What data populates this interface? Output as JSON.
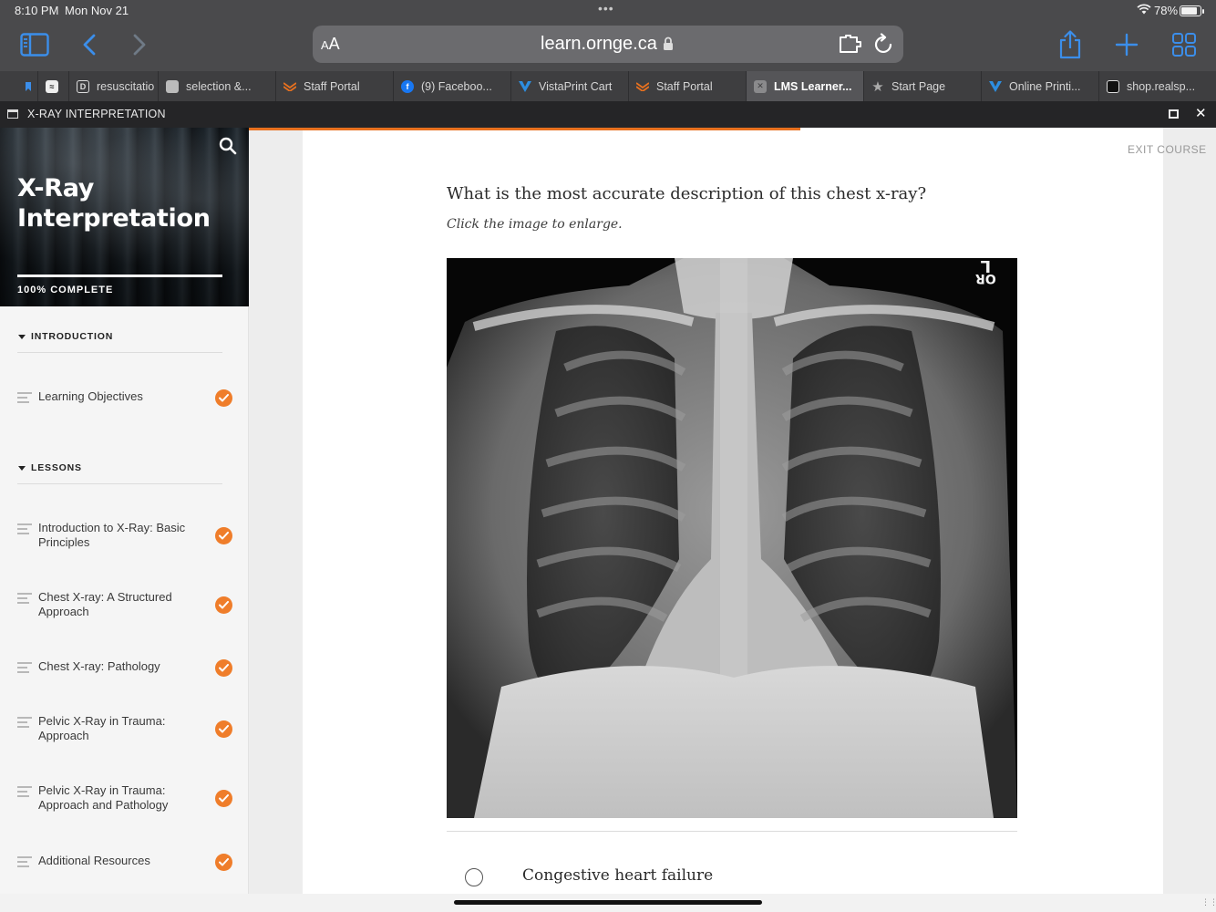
{
  "status_bar": {
    "time": "8:10 PM",
    "date": "Mon Nov 21",
    "battery": "78%"
  },
  "browser": {
    "text_size_label": "AA",
    "url": "learn.ornge.ca",
    "tabs": [
      {
        "label": "",
        "icon": "bookmark-icon"
      },
      {
        "label": "",
        "icon": "app-icon"
      },
      {
        "label": "resuscitatio",
        "icon": "d-square-icon"
      },
      {
        "label": "selection &...",
        "icon": "thumbnail-icon"
      },
      {
        "label": "Staff Portal",
        "icon": "ornge-logo-icon"
      },
      {
        "label": "(9) Faceboo...",
        "icon": "facebook-icon"
      },
      {
        "label": "VistaPrint Cart",
        "icon": "vistaprint-icon"
      },
      {
        "label": "Staff Portal",
        "icon": "ornge-logo-icon"
      },
      {
        "label": "LMS Learner...",
        "icon": "close-icon",
        "active": true
      },
      {
        "label": "Start Page",
        "icon": "star-icon"
      },
      {
        "label": "Online Printi...",
        "icon": "vistaprint-icon"
      },
      {
        "label": "shop.realsp...",
        "icon": "site-icon"
      }
    ]
  },
  "course_bar": {
    "title": "X-RAY INTERPRETATION"
  },
  "sidebar": {
    "course_title": "X-Ray Interpretation",
    "progress_label": "100% COMPLETE",
    "progress": 1.0,
    "sections": [
      {
        "heading": "INTRODUCTION",
        "lessons": [
          {
            "title": "Learning Objectives",
            "complete": true
          }
        ]
      },
      {
        "heading": "LESSONS",
        "lessons": [
          {
            "title": "Introduction to X-Ray: Basic Principles",
            "complete": true
          },
          {
            "title": "Chest X-ray: A Structured Approach",
            "complete": true
          },
          {
            "title": "Chest X-ray: Pathology",
            "complete": true
          },
          {
            "title": "Pelvic X-Ray in Trauma: Approach",
            "complete": true
          },
          {
            "title": "Pelvic X-Ray in Trauma: Approach and Pathology",
            "complete": true
          },
          {
            "title": "Additional Resources",
            "complete": true
          }
        ]
      }
    ]
  },
  "main": {
    "exit_label": "EXIT COURSE",
    "question": "What is the most accurate description of this chest x-ray?",
    "hint": "Click the image to enlarge.",
    "image_marker": "L\nOR",
    "options": [
      {
        "label": "Congestive heart failure"
      }
    ]
  },
  "colors": {
    "accent": "#ef7d2a",
    "chrome": "#4a4a4c",
    "tabs": "#3e3e40",
    "course_bar": "#252527",
    "link_blue": "#3b8eea"
  }
}
